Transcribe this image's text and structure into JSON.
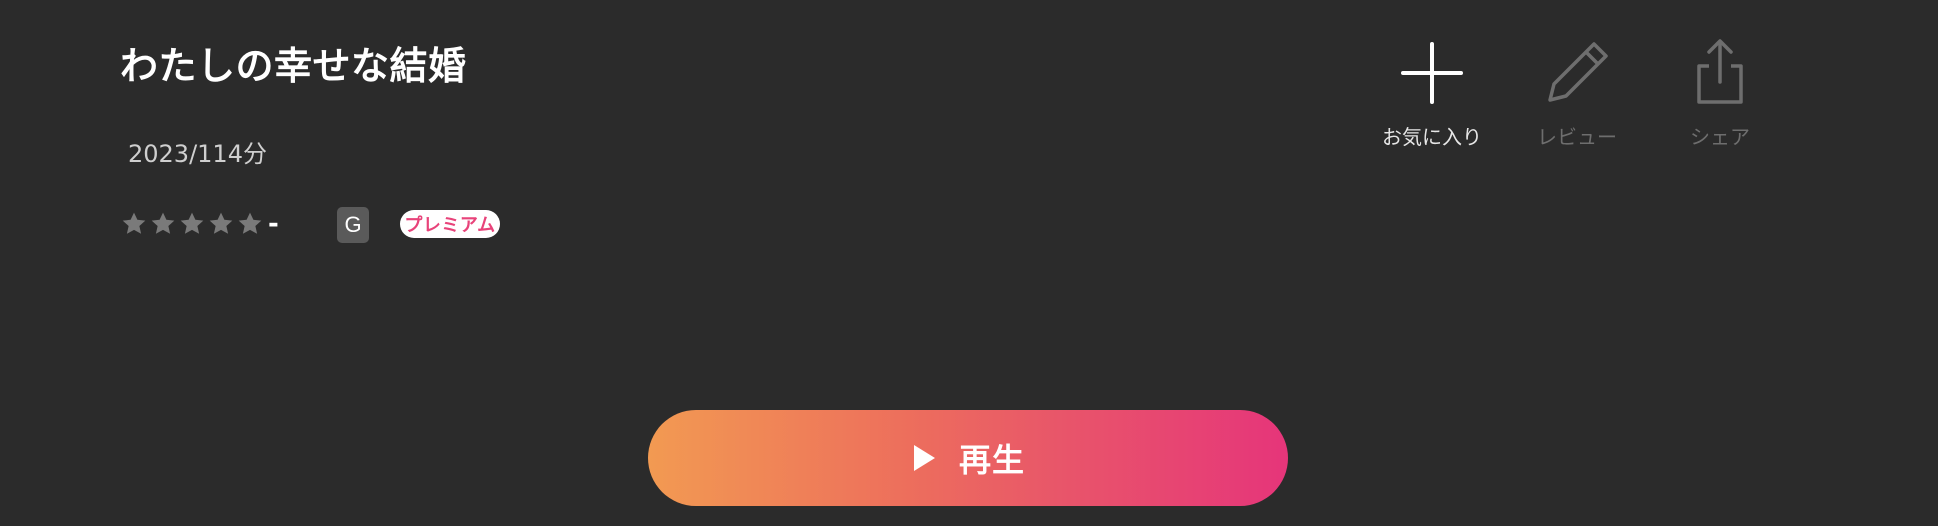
{
  "title": "わたしの幸せな結婚",
  "meta": "2023/114分",
  "rating": {
    "value": "-",
    "stars": 5,
    "star_color": "#7a7a7a"
  },
  "badges": {
    "age_rating": "G",
    "premium": "プレミアム"
  },
  "actions": {
    "favorite": {
      "label": "お気に入り",
      "icon": "plus-icon"
    },
    "review": {
      "label": "レビュー",
      "icon": "pencil-icon"
    },
    "share": {
      "label": "シェア",
      "icon": "share-icon"
    }
  },
  "play": {
    "label": "再生",
    "icon": "play-icon",
    "gradient_start": "#f29a52",
    "gradient_end": "#e6357a"
  },
  "colors": {
    "background": "#2b2b2b",
    "accent": "#e8437a"
  }
}
